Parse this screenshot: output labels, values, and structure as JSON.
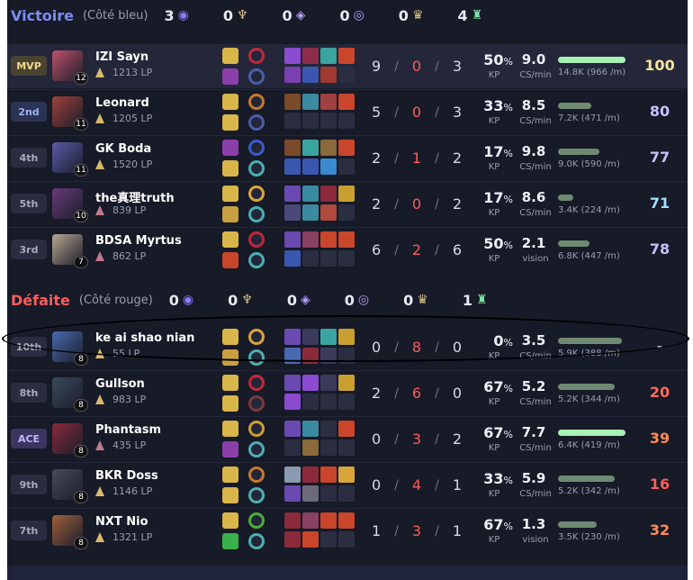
{
  "teams": [
    {
      "title": "Victoire",
      "subtitle": "(Côté bleu)",
      "title_color": "#7d8cf5",
      "objectives": [
        {
          "value": "3",
          "icon": "baron-icon",
          "color": "#8a7cff"
        },
        {
          "value": "0",
          "icon": "dragon-icon",
          "color": "#d9c38a"
        },
        {
          "value": "0",
          "icon": "herald-icon",
          "color": "#b7a0ff"
        },
        {
          "value": "0",
          "icon": "grub-icon",
          "color": "#b7a0ff"
        },
        {
          "value": "0",
          "icon": "atakhan-icon",
          "color": "#d9c38a"
        },
        {
          "value": "4",
          "icon": "tower-icon",
          "color": "#7ee2a6"
        }
      ],
      "players": [
        {
          "rank": "MVP",
          "rank_style": "mvp",
          "name": "IZI Sayn",
          "level": "12",
          "lp": "1213 LP",
          "emblem_color": "#d9b96a",
          "k": "9",
          "d": "0",
          "a": "3",
          "kp": "50",
          "kp_label": "KP",
          "cs": "9.0",
          "cs_label": "CS/min",
          "dmg": "14.8K (966 /m)",
          "dmg_frac": 1.0,
          "score": "100",
          "score_color": "#f6e3a0",
          "avatar_color": "#c0526a",
          "spells": [
            "#d9b64a",
            "#8b3fa8"
          ],
          "runes": [
            "#c2283b",
            "#4b5ea8"
          ],
          "items": [
            "#8a4bd0",
            "#8d2d4b",
            "#3aa5a0",
            "#c9462b",
            "#7a3fb0",
            "#3a57b0",
            "#a03a30",
            "#2b2e40"
          ]
        },
        {
          "rank": "2nd",
          "rank_style": "nd",
          "name": "Leonard",
          "level": "11",
          "lp": "1205 LP",
          "emblem_color": "#d9b96a",
          "k": "5",
          "d": "0",
          "a": "3",
          "kp": "33",
          "kp_label": "KP",
          "cs": "8.5",
          "cs_label": "CS/min",
          "dmg": "7.2K (471 /m)",
          "dmg_frac": 0.49,
          "score": "80",
          "score_color": "#c8c0ff",
          "avatar_color": "#a0423a",
          "spells": [
            "#d9b64a",
            "#d9b64a"
          ],
          "runes": [
            "#c47a2a",
            "#4b5ea8"
          ],
          "items": [
            "#7a4a2a",
            "#3a8aa0",
            "#a04040",
            "#c9462b",
            "#2b2e40",
            "#2b2e40",
            "#2b2e40",
            "#2b2e40"
          ]
        },
        {
          "rank": "4th",
          "rank_style": "",
          "name": "GK Boda",
          "level": "11",
          "lp": "1520 LP",
          "emblem_color": "#d9b96a",
          "k": "2",
          "d": "1",
          "a": "2",
          "kp": "17",
          "kp_label": "KP",
          "cs": "9.8",
          "cs_label": "CS/min",
          "dmg": "9.0K (590 /m)",
          "dmg_frac": 0.61,
          "score": "77",
          "score_color": "#c8c0ff",
          "avatar_color": "#5a5aa8",
          "spells": [
            "#8b3fa8",
            "#d9b64a"
          ],
          "runes": [
            "#3a5ad0",
            "#4ab0b0"
          ],
          "items": [
            "#7a4a2a",
            "#3aa5a0",
            "#8a6a3a",
            "#c9462b",
            "#3a57b0",
            "#3a57b0",
            "#3a8ad0",
            "#2b2e40"
          ]
        },
        {
          "rank": "5th",
          "rank_style": "",
          "name": "the真理truth",
          "level": "10",
          "lp": "839 LP",
          "emblem_color": "#c07a8a",
          "k": "2",
          "d": "0",
          "a": "2",
          "kp": "17",
          "kp_label": "KP",
          "cs": "8.6",
          "cs_label": "CS/min",
          "dmg": "3.4K (224 /m)",
          "dmg_frac": 0.23,
          "score": "71",
          "score_color": "#9fe0ff",
          "avatar_color": "#6a3a7a",
          "spells": [
            "#d9b64a",
            "#c9a040"
          ],
          "runes": [
            "#d9a43a",
            "#4ab0b0"
          ],
          "items": [
            "#6a4ab0",
            "#3a8aa0",
            "#8a2a3a",
            "#c9a030",
            "#4a4a7a",
            "#3a8aa0",
            "#b04a3a",
            "#2b2e40"
          ]
        },
        {
          "rank": "3rd",
          "rank_style": "",
          "name": "BDSA Myrtus",
          "level": "7",
          "lp": "862 LP",
          "emblem_color": "#c07a8a",
          "k": "6",
          "d": "2",
          "a": "6",
          "kp": "50",
          "kp_label": "KP",
          "cs": "2.1",
          "cs_label": "vision",
          "dmg": "6.8K (447 /m)",
          "dmg_frac": 0.46,
          "score": "78",
          "score_color": "#c8c0ff",
          "avatar_color": "#b8a890",
          "spells": [
            "#d9b64a",
            "#c9462b"
          ],
          "runes": [
            "#c2283b",
            "#4ab0b0"
          ],
          "items": [
            "#6a4ab0",
            "#8a4060",
            "#c9462b",
            "#c9462b",
            "#3a57b0",
            "#2b2e40",
            "#2b2e40",
            "#2b2e40"
          ]
        }
      ]
    },
    {
      "title": "Défaite",
      "subtitle": "(Côté rouge)",
      "title_color": "#ff5c5c",
      "objectives": [
        {
          "value": "0",
          "icon": "baron-icon",
          "color": "#8a7cff"
        },
        {
          "value": "0",
          "icon": "dragon-icon",
          "color": "#d9c38a"
        },
        {
          "value": "0",
          "icon": "herald-icon",
          "color": "#b7a0ff"
        },
        {
          "value": "0",
          "icon": "grub-icon",
          "color": "#b7a0ff"
        },
        {
          "value": "0",
          "icon": "atakhan-icon",
          "color": "#d9c38a"
        },
        {
          "value": "1",
          "icon": "tower-icon",
          "color": "#7ee2a6"
        }
      ],
      "players": [
        {
          "rank": "10th",
          "rank_style": "",
          "name": "ke ai shao nian",
          "level": "8",
          "lp": "55 LP",
          "emblem_color": "#d9b96a",
          "k": "0",
          "d": "8",
          "a": "0",
          "kp": "0",
          "kp_label": "KP",
          "cs": "3.5",
          "cs_label": "CS/min",
          "dmg": "5.9K (388 /m)",
          "dmg_frac": 0.95,
          "score": "-",
          "score_color": "#d8dae6",
          "avatar_color": "#4a6ab0",
          "spells": [
            "#d9b64a",
            "#c9a040"
          ],
          "runes": [
            "#d9a43a",
            "#4ab0b0"
          ],
          "items": [
            "#6a4ab0",
            "#3a3a5a",
            "#3aa5a0",
            "#c9a030",
            "#4a6ab0",
            "#8a2a3a",
            "#3a3a5a",
            "#2b2e40"
          ]
        },
        {
          "rank": "8th",
          "rank_style": "",
          "name": "Gullson",
          "level": "8",
          "lp": "983 LP",
          "emblem_color": "#d9b96a",
          "k": "2",
          "d": "6",
          "a": "0",
          "kp": "67",
          "kp_label": "KP",
          "cs": "5.2",
          "cs_label": "CS/min",
          "dmg": "5.2K (344 /m)",
          "dmg_frac": 0.84,
          "score": "20",
          "score_color": "#ff6a5a",
          "avatar_color": "#3a4a5a",
          "spells": [
            "#d9b64a",
            "#d9b64a"
          ],
          "runes": [
            "#c2283b",
            "#7a3a3a"
          ],
          "items": [
            "#6a4ab0",
            "#8a4bd0",
            "#3a3a5a",
            "#c9a030",
            "#8a4bd0",
            "#2b2e40",
            "#2b2e40",
            "#2b2e40"
          ]
        },
        {
          "rank": "ACE",
          "rank_style": "ace",
          "name": "Phantasm",
          "level": "8",
          "lp": "435 LP",
          "emblem_color": "#c07a8a",
          "k": "0",
          "d": "3",
          "a": "2",
          "kp": "67",
          "kp_label": "KP",
          "cs": "7.7",
          "cs_label": "CS/min",
          "dmg": "6.4K (419 /m)",
          "dmg_frac": 1.0,
          "score": "39",
          "score_color": "#ff8a5a",
          "avatar_color": "#8a2a3a",
          "spells": [
            "#d9b64a",
            "#8b3fa8"
          ],
          "runes": [
            "#c9a030",
            "#4ab0b0"
          ],
          "items": [
            "#6a4ab0",
            "#3a8aa0",
            "#2b2e40",
            "#c9462b",
            "#2b2e40",
            "#8a6a3a",
            "#2b2e40",
            "#2b2e40"
          ]
        },
        {
          "rank": "9th",
          "rank_style": "",
          "name": "BKR Doss",
          "level": "8",
          "lp": "1146 LP",
          "emblem_color": "#d9b96a",
          "k": "0",
          "d": "4",
          "a": "1",
          "kp": "33",
          "kp_label": "KP",
          "cs": "5.9",
          "cs_label": "CS/min",
          "dmg": "5.2K (342 /m)",
          "dmg_frac": 0.84,
          "score": "16",
          "score_color": "#ff5c5c",
          "avatar_color": "#4a4a5a",
          "spells": [
            "#d9b64a",
            "#d9b64a"
          ],
          "runes": [
            "#c47a2a",
            "#4ab0b0"
          ],
          "items": [
            "#8a9ab0",
            "#8a2a3a",
            "#c9462b",
            "#d9a43a",
            "#6a4ab0",
            "#6a6a7a",
            "#2b2e40",
            "#2b2e40"
          ]
        },
        {
          "rank": "7th",
          "rank_style": "",
          "name": "NXT Nio",
          "level": "8",
          "lp": "1321 LP",
          "emblem_color": "#d9b96a",
          "k": "1",
          "d": "3",
          "a": "1",
          "kp": "67",
          "kp_label": "KP",
          "cs": "1.3",
          "cs_label": "vision",
          "dmg": "3.5K (230 /m)",
          "dmg_frac": 0.57,
          "score": "32",
          "score_color": "#ff8a5a",
          "avatar_color": "#a0603a",
          "spells": [
            "#d9b64a",
            "#3ab04a"
          ],
          "runes": [
            "#4ab03a",
            "#4ab0b0"
          ],
          "items": [
            "#8a2a3a",
            "#8a4060",
            "#c9462b",
            "#c9462b",
            "#8a2a3a",
            "#c9462b",
            "#2b2e40",
            "#2b2e40"
          ]
        }
      ]
    }
  ]
}
